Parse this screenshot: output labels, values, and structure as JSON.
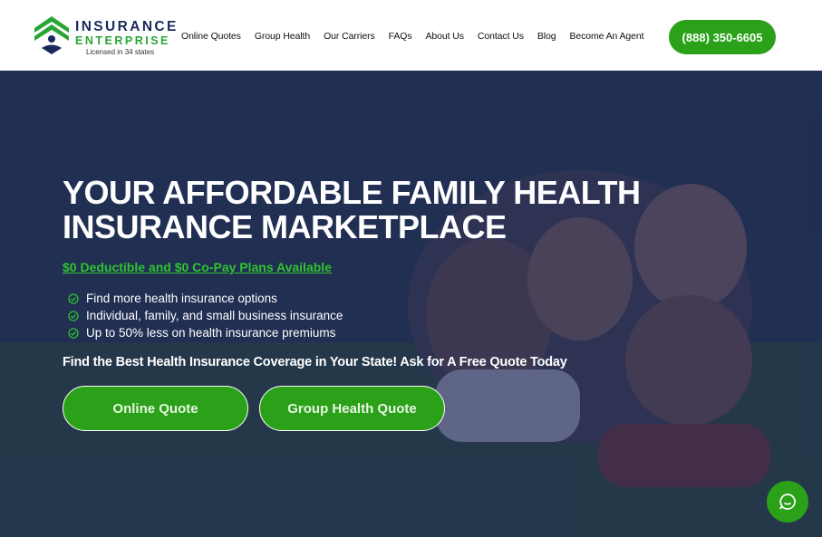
{
  "brand": {
    "line1": "INSURANCE",
    "line2": "ENTERPRISE",
    "tagline": "Licensed in 34 states",
    "colors": {
      "navy": "#1b2a5c",
      "green": "#2aa534"
    }
  },
  "nav": {
    "items": [
      {
        "label": "Online Quotes"
      },
      {
        "label": "Group Health"
      },
      {
        "label": "Our Carriers"
      },
      {
        "label": "FAQs"
      },
      {
        "label": "About Us"
      },
      {
        "label": "Contact Us"
      },
      {
        "label": "Blog"
      },
      {
        "label": "Become An Agent"
      }
    ],
    "phone": "(888) 350-6605"
  },
  "hero": {
    "headline_line1": "YOUR AFFORDABLE FAMILY HEALTH",
    "headline_line2": "INSURANCE MARKETPLACE",
    "subheadline": "$0 Deductible and $0 Co-Pay Plans Available",
    "bullets": [
      "Find more health insurance options",
      "Individual, family, and small business insurance",
      "Up to 50% less on health insurance premiums"
    ],
    "tagline": "Find the Best Health Insurance Coverage in Your State! Ask for A Free Quote Today",
    "cta_primary": "Online Quote",
    "cta_secondary": "Group Health Quote",
    "accent": "#2aa118"
  },
  "chat": {
    "icon": "chat-icon"
  }
}
